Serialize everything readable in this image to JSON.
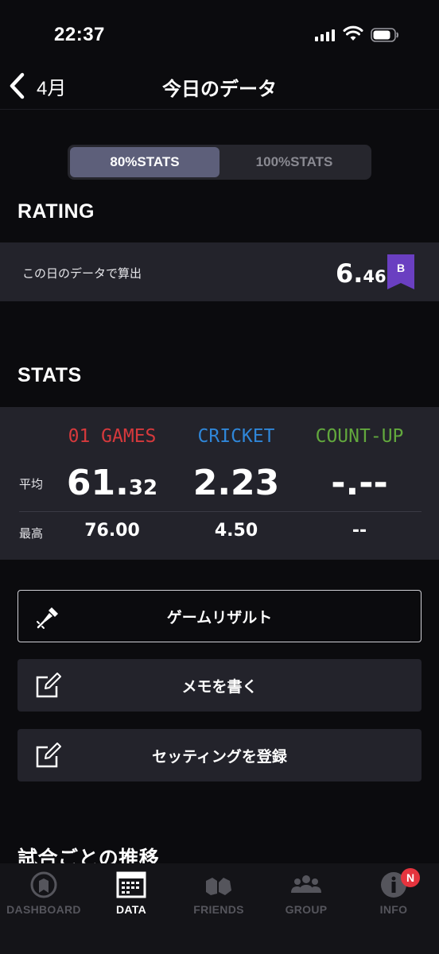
{
  "status_bar": {
    "time": "22:37"
  },
  "nav": {
    "back_label": "4月",
    "title": "今日のデータ"
  },
  "segmented": {
    "options": [
      "80%STATS",
      "100%STATS"
    ],
    "selected": "80%STATS"
  },
  "rating": {
    "section_title": "RATING",
    "label": "この日のデータで算出",
    "value_int": "6.",
    "value_dec": "46",
    "badge": "B",
    "badge_color": "#6a3fc1"
  },
  "stats": {
    "section_title": "STATS",
    "columns": [
      {
        "name": "01 GAMES",
        "color": "#d6393c",
        "avg_int": "61.",
        "avg_dec": "32",
        "max": "76.00"
      },
      {
        "name": "CRICKET",
        "color": "#2f86d8",
        "avg_int": "2.23",
        "avg_dec": "",
        "max": "4.50"
      },
      {
        "name": "COUNT-UP",
        "color": "#62a83d",
        "avg_int": "-.--",
        "avg_dec": "",
        "max": "--"
      }
    ],
    "row_labels": {
      "avg": "平均",
      "max": "最高"
    }
  },
  "actions": {
    "game_result": "ゲームリザルト",
    "write_memo": "メモを書く",
    "register_setting": "セッティングを登録"
  },
  "trend_title": "試合ごとの推移",
  "tabs": [
    {
      "label": "DASHBOARD",
      "icon": "dashboard-icon"
    },
    {
      "label": "DATA",
      "icon": "calendar-icon"
    },
    {
      "label": "FRIENDS",
      "icon": "friends-icon"
    },
    {
      "label": "GROUP",
      "icon": "group-icon"
    },
    {
      "label": "INFO",
      "icon": "info-icon",
      "badge": "N"
    }
  ],
  "active_tab": "DATA"
}
